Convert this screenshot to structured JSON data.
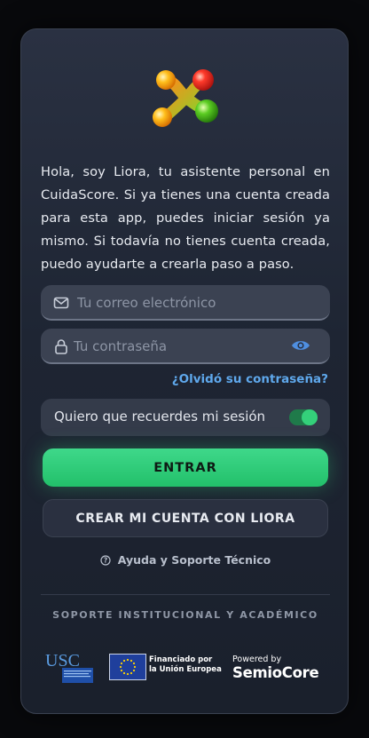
{
  "intro_text": "Hola, soy Liora, tu asistente personal en CuidaScore. Si ya tienes una cuenta creada para esta app, puedes iniciar sesión ya mismo. Si todavía no tienes cuenta creada, puedo ayudarte a crearla paso a paso.",
  "email_field": {
    "placeholder": "Tu correo electrónico",
    "value": "",
    "icon": "mail-icon"
  },
  "password_field": {
    "placeholder": "Tu contraseña",
    "value": "",
    "icon": "lock-icon",
    "toggle_icon": "eye-icon"
  },
  "forgot_link": "¿Olvidó su contraseña?",
  "remember": {
    "label": "Quiero que recuerdes mi sesión",
    "enabled": true
  },
  "buttons": {
    "enter": "ENTRAR",
    "create": "CREAR MI CUENTA CON LIORA"
  },
  "help_link": "Ayuda y Soporte Técnico",
  "institutional": {
    "title": "SOPORTE INSTITUCIONAL Y ACADÉMICO",
    "usc_logo": "USC",
    "eu_text_line1": "Financiado por",
    "eu_text_line2": "la Unión Europea",
    "powered_by": "Powered by",
    "semiocore": "SemioCore"
  },
  "colors": {
    "accent_green": "#34d07a",
    "link_blue": "#5fa8ec",
    "card_bg": "#1e2533"
  }
}
